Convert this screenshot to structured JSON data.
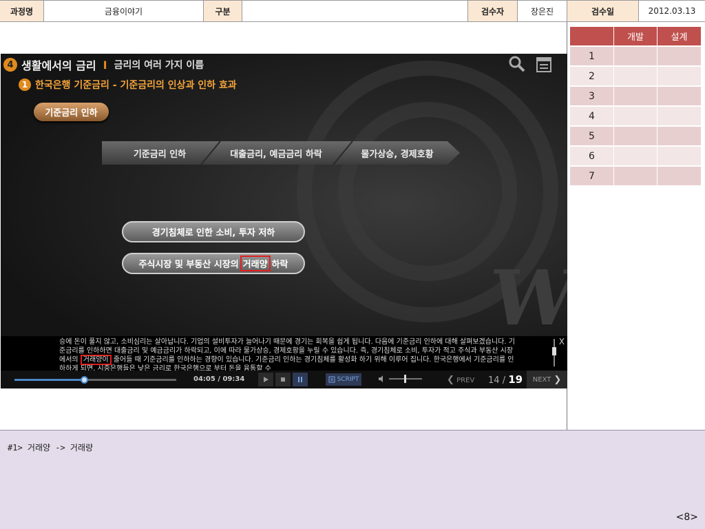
{
  "header": {
    "course_label": "과정명",
    "course_value": "금융이야기",
    "type_label": "구분",
    "type_value": "",
    "reviewer_label": "검수자",
    "reviewer_value": "장은진",
    "date_label": "검수일",
    "date_value": "2012.03.13"
  },
  "review_table": {
    "headers": [
      "",
      "개발",
      "설계"
    ],
    "rows": [
      "1",
      "2",
      "3",
      "4",
      "5",
      "6",
      "7"
    ]
  },
  "video": {
    "chapter_num": "4",
    "chapter_title": "생활에서의 금리",
    "separator": "I",
    "chapter_sub": "금리의 여러 가지 이름",
    "section_num": "1",
    "section_title": "한국은행 기준금리 - 기준금리의 인상과 인하 효과",
    "pill_label": "기준금리 인하",
    "flow": [
      "기준금리 인하",
      "대출금리, 예금금리 하락",
      "물가상승, 경제호황"
    ],
    "result1": "경기침체로 인한 소비, 투자 저하",
    "result2_pre": "주식시장 및 부동산 시장의",
    "result2_hl": "거래양",
    "result2_post": "하락",
    "big_symbol": "W",
    "icons": [
      "search-icon",
      "notes-icon"
    ],
    "script_text_1": "승에 돈이 풀지 않고, 소비심리는 살아납니다. 기업의 설비투자가 늘어나기 때문에 경기는 회복을 쉽게 됩니다. 다음에 기준금리 인하에 대해 살펴보겠습니다. 기준금리를 인하하면 대출금리 및 예금금리가 하락되고, 이에 따라 물가상승, 경제호황을 누릴 수 있습니다. 즉, 경기침체로 소비, 투자가 적고 주식과 부동산 시장에서의",
    "script_hl": "거래양이",
    "script_text_2": "줄어들 때 기준금리를 인하하는 경향이 있습니다. 기준금리 인하는 경기침체를 활성화 하기 위해 이루어 집니다. 한국은행에서 기준금리를 인하하게 되면, 시중은행들은 낮은 금리로 한국은행으로 부터 돈을 융통할 수",
    "close": "X",
    "time": "04:05 / 09:34",
    "progress": 0.43,
    "script_btn": "SCRIPT",
    "prev": "PREV",
    "page_current": "14",
    "page_sep": "/",
    "page_total": "19",
    "next": "NEXT"
  },
  "note": {
    "text": "#1> 거래양 -> 거래량",
    "page": "<8>"
  },
  "colors": {
    "header_label_bg": "#fbe8d4",
    "table_header_bg": "#c0504d",
    "note_bg": "#e4dcea",
    "highlight": "#e02020"
  }
}
